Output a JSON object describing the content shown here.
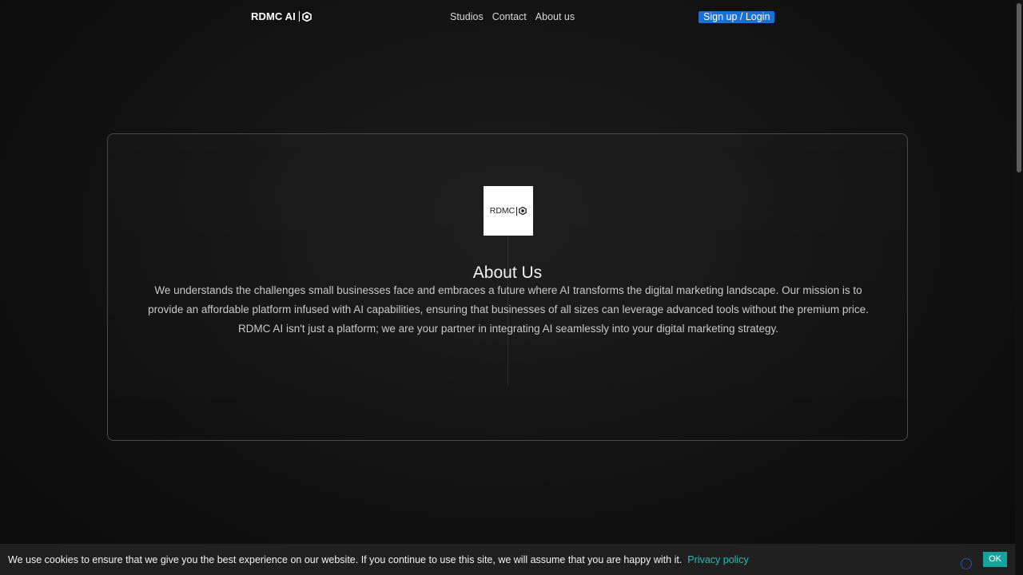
{
  "header": {
    "logo_text": "RDMC AI",
    "logo_icon": "hexagon-logo-icon",
    "nav": [
      {
        "label": "Studios"
      },
      {
        "label": "Contact"
      },
      {
        "label": "About us"
      }
    ],
    "signup_label": "Sign up / Login"
  },
  "about": {
    "logo_text": "RDMC",
    "title": "About Us",
    "body": "We understands the challenges small businesses face and embraces a future where AI transforms the digital marketing landscape. Our mission is to provide an affordable platform infused with AI capabilities, ensuring that businesses of all sizes can leverage advanced tools without the premium price. RDMC AI isn't just a platform; we are your partner in integrating AI seamlessly into your digital marketing strategy."
  },
  "cookie": {
    "text": "We use cookies to ensure that we give you the best experience on our website. If you continue to use this site, we will assume that you are happy with it.",
    "link": "Privacy policy",
    "ok": "OK"
  },
  "colors": {
    "accent_button": "#1b6fd8",
    "cookie_link": "#2ab9b4",
    "ok_button": "#16a39c",
    "background": "#121212"
  }
}
